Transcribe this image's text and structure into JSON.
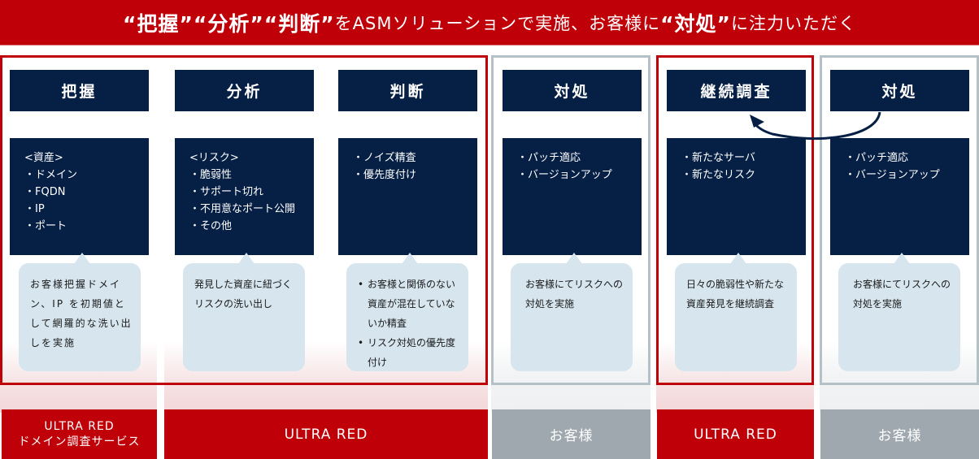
{
  "header": {
    "q1": "“把握”",
    "q2": "“分析”",
    "q3": "“判断”",
    "mid": "をASMソリューションで実施、お客様に",
    "q4": "“対処”",
    "end": "に注力いただく"
  },
  "columns": [
    {
      "title": "把握",
      "items": [
        "<資産>",
        "・ドメイン",
        "・FQDN",
        "・IP",
        "・ポート"
      ],
      "bubble_lines": [
        "お客様把握ドメイン、IP を初期値として網羅的な洗い出しを実施"
      ],
      "bubble_bullets": []
    },
    {
      "title": "分析",
      "items": [
        "<リスク>",
        "・脆弱性",
        "・サポート切れ",
        "・不用意なポート公開",
        "・その他"
      ],
      "bubble_lines": [
        "発見した資産に紐づくリスクの洗い出し"
      ],
      "bubble_bullets": []
    },
    {
      "title": "判断",
      "items": [
        "・ノイズ精査",
        "・優先度付け"
      ],
      "bubble_lines": [],
      "bubble_bullets": [
        "お客様と関係のない資産が混在していないか精査",
        "リスク対処の優先度付け"
      ]
    },
    {
      "title": "対処",
      "items": [
        "・パッチ適応",
        "・バージョンアップ"
      ],
      "bubble_lines": [
        "お客様にてリスクへの対処を実施"
      ],
      "bubble_bullets": []
    },
    {
      "title": "継続調査",
      "items": [
        "・新たなサーバ",
        "・新たなリスク"
      ],
      "bubble_lines": [
        "日々の脆弱性や新たな資産発見を継続調査"
      ],
      "bubble_bullets": []
    },
    {
      "title": "対処",
      "items": [
        "・パッチ適応",
        "・バージョンアップ"
      ],
      "bubble_lines": [
        "お客様にてリスクへの対処を実施"
      ],
      "bubble_bullets": []
    }
  ],
  "footers": [
    {
      "line1": "ULTRA RED",
      "line2": "ドメイン調査サービス"
    },
    {
      "label": "ULTRA RED"
    },
    {
      "label": "お客様"
    },
    {
      "label": "ULTRA RED"
    },
    {
      "label": "お客様"
    }
  ],
  "colors": {
    "brand_red": "#bf0008",
    "navy": "#061f45",
    "bubble": "#d6e5ee",
    "customer_gray": "#9fa8ae"
  }
}
